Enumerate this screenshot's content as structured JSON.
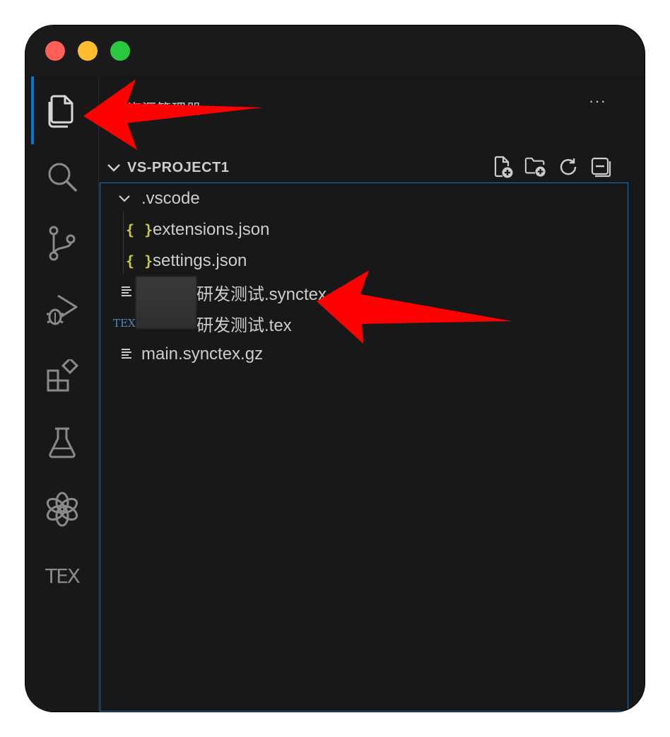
{
  "window": {
    "traffic_lights": [
      "close",
      "minimize",
      "zoom"
    ]
  },
  "activity_bar": {
    "items": [
      {
        "name": "explorer",
        "icon": "files-icon",
        "active": true
      },
      {
        "name": "search",
        "icon": "search-icon"
      },
      {
        "name": "source-control",
        "icon": "source-control-icon"
      },
      {
        "name": "run-and-debug",
        "icon": "run-debug-icon"
      },
      {
        "name": "extensions",
        "icon": "extensions-icon"
      },
      {
        "name": "testing",
        "icon": "beaker-icon"
      },
      {
        "name": "chatgpt",
        "icon": "openai-icon"
      },
      {
        "name": "latex",
        "icon": "tex-icon",
        "label": "TEX"
      }
    ]
  },
  "sidebar": {
    "title": "资源管理器",
    "more_actions": "···",
    "section": {
      "title": "VS-PROJECT1",
      "actions": [
        "new-file-icon",
        "new-folder-icon",
        "refresh-icon",
        "collapse-all-icon"
      ]
    },
    "tree": [
      {
        "label": ".vscode",
        "type": "folder",
        "expanded": true
      },
      {
        "label": "extensions.json",
        "type": "json",
        "icon_text": "{ }"
      },
      {
        "label": "settings.json",
        "type": "json",
        "icon_text": "{ }"
      },
      {
        "label": "研发测试.synctex.gz",
        "type": "text"
      },
      {
        "label": "研发测试.tex",
        "type": "tex",
        "icon_text": "TEX"
      },
      {
        "label": "main.synctex.gz",
        "type": "text"
      }
    ]
  },
  "colors": {
    "accent": "#0078d4",
    "json": "#cbcb41",
    "tex": "#4b8bbe",
    "annotation_arrow": "#ff0000"
  }
}
